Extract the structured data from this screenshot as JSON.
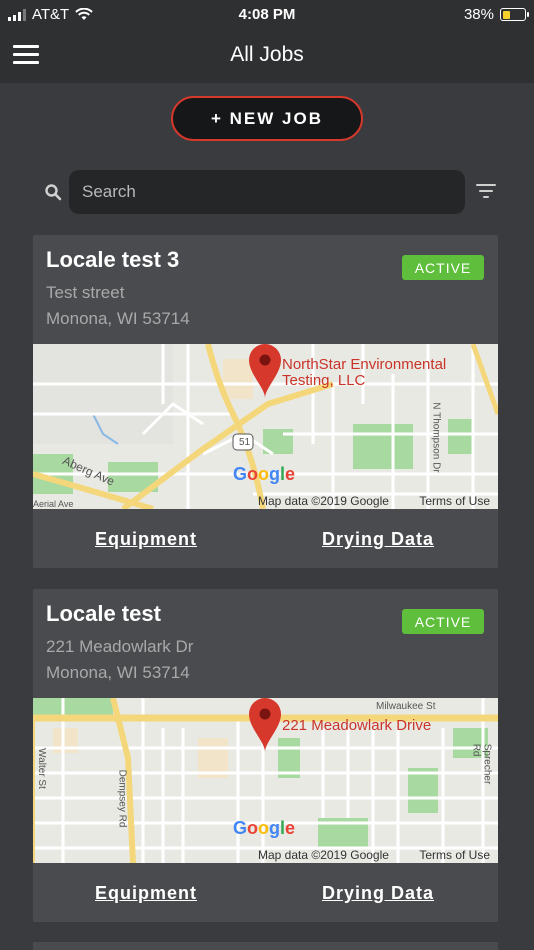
{
  "status_bar": {
    "carrier": "AT&T",
    "time": "4:08 PM",
    "battery": "38%",
    "battery_level": 0.38
  },
  "nav": {
    "title": "All Jobs",
    "menu_icon": "hamburger-menu-icon"
  },
  "actions": {
    "new_job_label": "+ NEW JOB"
  },
  "search": {
    "placeholder": "Search",
    "value": "",
    "icon": "search-icon",
    "filter_icon": "filter-icon"
  },
  "colors": {
    "accent_red": "#d6382b",
    "active_green": "#5fbf3c",
    "card_bg": "#4a4b4e",
    "page_bg": "#3a3b3e"
  },
  "jobs": [
    {
      "title": "Locale test 3",
      "status": "ACTIVE",
      "address_line1": "Test street",
      "address_line2": "Monona, WI 53714",
      "map": {
        "pin_label": "NorthStar Environmental Testing, LLC",
        "logo": "Google",
        "attribution": "Map data ©2019 Google",
        "terms": "Terms of Use",
        "roads": [
          "Aberg Ave",
          "N Thompson Dr",
          "51",
          "Aerial Ave"
        ]
      },
      "links": {
        "equipment": "Equipment",
        "drying_data": "Drying Data"
      }
    },
    {
      "title": "Locale test",
      "status": "ACTIVE",
      "address_line1": "221 Meadowlark Dr",
      "address_line2": "Monona, WI 53714",
      "map": {
        "pin_label": "221 Meadowlark Drive",
        "logo": "Google",
        "attribution": "Map data ©2019 Google",
        "terms": "Terms of Use",
        "roads": [
          "Milwaukee St",
          "Walter St",
          "Dempsey Rd",
          "Sprecher Rd"
        ]
      },
      "links": {
        "equipment": "Equipment",
        "drying_data": "Drying Data"
      }
    }
  ]
}
